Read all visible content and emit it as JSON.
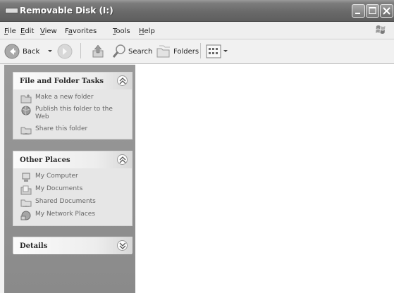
{
  "window": {
    "title": "Removable Disk (I:)"
  },
  "menu": {
    "file": {
      "u": "F",
      "rest": "ile"
    },
    "edit": {
      "u": "E",
      "rest": "dit"
    },
    "view": {
      "u": "V",
      "rest": "iew"
    },
    "favorites": {
      "pre": "F",
      "u": "a",
      "rest": "vorites"
    },
    "tools": {
      "u": "T",
      "rest": "ools"
    },
    "help": {
      "u": "H",
      "rest": "elp"
    }
  },
  "toolbar": {
    "back": "Back",
    "search": "Search",
    "folders": "Folders"
  },
  "panels": {
    "file_tasks": {
      "title": "File and Folder Tasks",
      "items": [
        "Make a new folder",
        "Publish this folder to the Web",
        "Share this folder"
      ]
    },
    "other_places": {
      "title": "Other Places",
      "items": [
        "My Computer",
        "My Documents",
        "Shared Documents",
        "My Network Places"
      ]
    },
    "details": {
      "title": "Details"
    }
  },
  "icons": [
    "app-window-icon",
    "minimize-icon",
    "maximize-icon",
    "close-icon",
    "windows-logo-icon",
    "back-arrow-icon",
    "forward-arrow-icon",
    "up-folder-icon",
    "search-icon",
    "folders-icon",
    "views-icon",
    "collapse-chevron-icon",
    "expand-chevron-icon",
    "new-folder-icon",
    "globe-icon",
    "share-icon",
    "my-computer-icon",
    "my-documents-icon",
    "shared-documents-icon",
    "network-places-icon"
  ]
}
